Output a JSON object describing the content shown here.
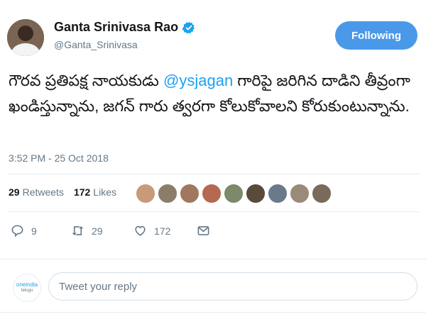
{
  "profile": {
    "name": "Ganta Srinivasa Rao",
    "handle": "@Ganta_Srinivasa",
    "follow_label": "Following"
  },
  "tweet": {
    "part1": "గౌరవ ప్రతిపక్ష నాయకుడు ",
    "mention": "@ysjagan",
    "part2": " గారిపై జరిగిన దాడిని తీవ్రంగా ఖండిస్తున్నాను, జగన్ గారు త్వరగా కోలుకోవాలని కోరుకుంటున్నాను.",
    "timestamp": "3:52 PM - 25 Oct 2018"
  },
  "stats": {
    "retweets_count": "29",
    "retweets_label": "Retweets",
    "likes_count": "172",
    "likes_label": "Likes"
  },
  "likers": [
    "#c89a7a",
    "#8a7e6a",
    "#a07860",
    "#b46a50",
    "#7a8a6a",
    "#5a4a3a",
    "#6a7a8a",
    "#9a8a7a",
    "#7a6a5a"
  ],
  "actions": {
    "reply_count": "9",
    "retweet_count": "29",
    "like_count": "172"
  },
  "reply": {
    "placeholder": "Tweet your reply",
    "logo_line1": "oneindia",
    "logo_line2": "telugu"
  },
  "colors": {
    "accent": "#1da1f2",
    "follow_button": "#4a99e9"
  }
}
